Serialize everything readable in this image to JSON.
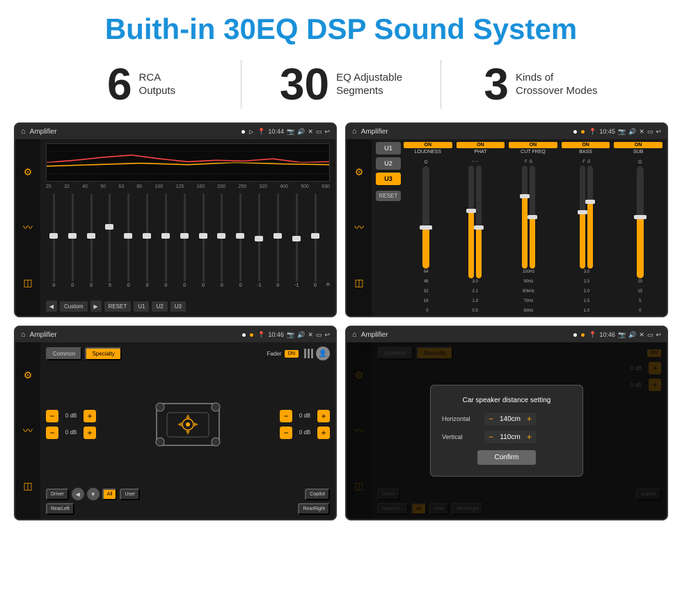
{
  "header": {
    "title": "Buith-in 30EQ DSP Sound System"
  },
  "stats": [
    {
      "number": "6",
      "label": "RCA\nOutputs"
    },
    {
      "number": "30",
      "label": "EQ Adjustable\nSegments"
    },
    {
      "number": "3",
      "label": "Kinds of\nCrossover Modes"
    }
  ],
  "screens": [
    {
      "id": "eq-screen",
      "status_time": "10:44",
      "title": "Amplifier",
      "eq_freqs": [
        "25",
        "32",
        "40",
        "50",
        "63",
        "80",
        "100",
        "125",
        "160",
        "200",
        "250",
        "320",
        "400",
        "500",
        "630"
      ],
      "eq_values": [
        "0",
        "0",
        "0",
        "5",
        "0",
        "0",
        "0",
        "0",
        "0",
        "0",
        "0",
        "-1",
        "0",
        "-1"
      ],
      "preset": "Custom",
      "buttons": [
        "RESET",
        "U1",
        "U2",
        "U3"
      ]
    },
    {
      "id": "crossover-screen",
      "status_time": "10:45",
      "title": "Amplifier",
      "presets": [
        "U1",
        "U2",
        "U3"
      ],
      "controls": [
        "LOUDNESS",
        "PHAT",
        "CUT FREQ",
        "BASS",
        "SUB"
      ],
      "on_states": [
        true,
        true,
        true,
        true,
        true
      ]
    },
    {
      "id": "fader-screen",
      "status_time": "10:46",
      "title": "Amplifier",
      "tabs": [
        "Common",
        "Specialty"
      ],
      "active_tab": "Specialty",
      "fader_label": "Fader",
      "fader_on": "ON",
      "vol_rows": [
        {
          "val": "0 dB"
        },
        {
          "val": "0 dB"
        },
        {
          "val": "0 dB"
        },
        {
          "val": "0 dB"
        }
      ],
      "speaker_labels": [
        "Driver",
        "Copilot",
        "RearLeft",
        "All",
        "User",
        "RearRight"
      ]
    },
    {
      "id": "dialog-screen",
      "status_time": "10:46",
      "title": "Amplifier",
      "dialog_title": "Car speaker distance setting",
      "fields": [
        {
          "label": "Horizontal",
          "value": "140cm"
        },
        {
          "label": "Vertical",
          "value": "110cm"
        }
      ],
      "confirm_label": "Confirm",
      "speaker_labels_bottom": [
        "Driver",
        "Copilot",
        "RearLef...",
        "User",
        "RearRight"
      ],
      "vol_right": [
        "0 dB",
        "0 dB"
      ]
    }
  ]
}
